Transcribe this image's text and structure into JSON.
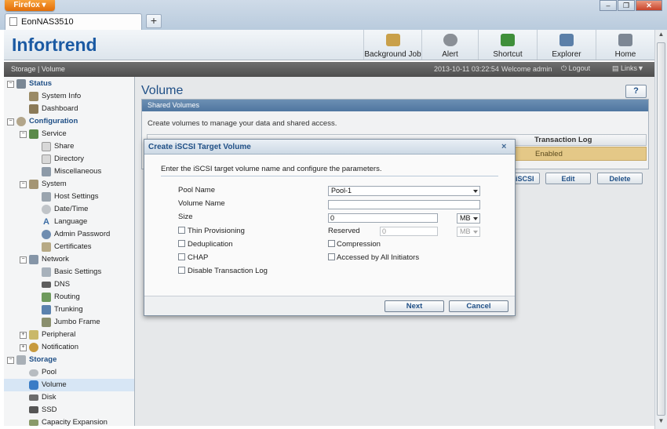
{
  "browser": {
    "app_button": "Firefox",
    "tab_title": "EonNAS3510",
    "new_tab": "+",
    "window_controls": {
      "minimize": "–",
      "restore": "❐",
      "close": "✕"
    }
  },
  "header": {
    "logo": "Infortrend",
    "buttons": [
      {
        "label": "Background Job",
        "icon": "background-job-icon",
        "color": "#c9a04a"
      },
      {
        "label": "Alert",
        "icon": "alert-icon",
        "color": "#8a8f96"
      },
      {
        "label": "Shortcut",
        "icon": "shortcut-icon",
        "color": "#3f8f3a"
      },
      {
        "label": "Explorer",
        "icon": "explorer-icon",
        "color": "#5b7fa8"
      },
      {
        "label": "Home",
        "icon": "home-icon",
        "color": "#7d8794"
      }
    ]
  },
  "statusbar": {
    "breadcrumb": "Storage | Volume",
    "datetime": "2013-10-11 03:22:54",
    "welcome": "Welcome admin",
    "logout": "Logout",
    "links": "Links▼"
  },
  "sidebar": {
    "groups": [
      {
        "label": "Status",
        "items": [
          "System Info",
          "Dashboard"
        ]
      },
      {
        "label": "Configuration"
      },
      {
        "label": "Service",
        "items": [
          "Share",
          "Directory",
          "Miscellaneous"
        ]
      },
      {
        "label": "System",
        "items": [
          "Host Settings",
          "Date/Time",
          "Language",
          "Admin Password",
          "Certificates"
        ]
      },
      {
        "label": "Network",
        "items": [
          "Basic Settings",
          "DNS",
          "Routing",
          "Trunking",
          "Jumbo Frame"
        ]
      },
      {
        "label": "Peripheral"
      },
      {
        "label": "Notification"
      },
      {
        "label": "Storage",
        "items": [
          "Pool",
          "Volume",
          "Disk",
          "SSD",
          "Capacity Expansion"
        ]
      }
    ],
    "selected": "Volume"
  },
  "main": {
    "title": "Volume",
    "help": "?",
    "panel_title": "Shared Volumes",
    "panel_desc": "Create volumes to manage your data and shared access.",
    "column_transaction_log": "Transaction Log",
    "row_transaction_log": "Enabled",
    "toolbar": {
      "iscsi": "e iSCSI",
      "edit": "Edit",
      "delete": "Delete"
    }
  },
  "dialog": {
    "title": "Create iSCSI Target Volume",
    "close": "×",
    "intro": "Enter the iSCSI target volume name and configure the parameters.",
    "pool_name_label": "Pool Name",
    "pool_name_value": "Pool-1",
    "volume_name_label": "Volume Name",
    "volume_name_value": "",
    "size_label": "Size",
    "size_value": "0",
    "size_unit": "MB",
    "thin_provisioning": "Thin Provisioning",
    "reserved_label": "Reserved",
    "reserved_value": "0",
    "reserved_unit": "MB",
    "deduplication": "Deduplication",
    "compression": "Compression",
    "chap": "CHAP",
    "accessed_by_all": "Accessed by All Initiators",
    "disable_transaction_log": "Disable Transaction Log",
    "next": "Next",
    "cancel": "Cancel"
  }
}
